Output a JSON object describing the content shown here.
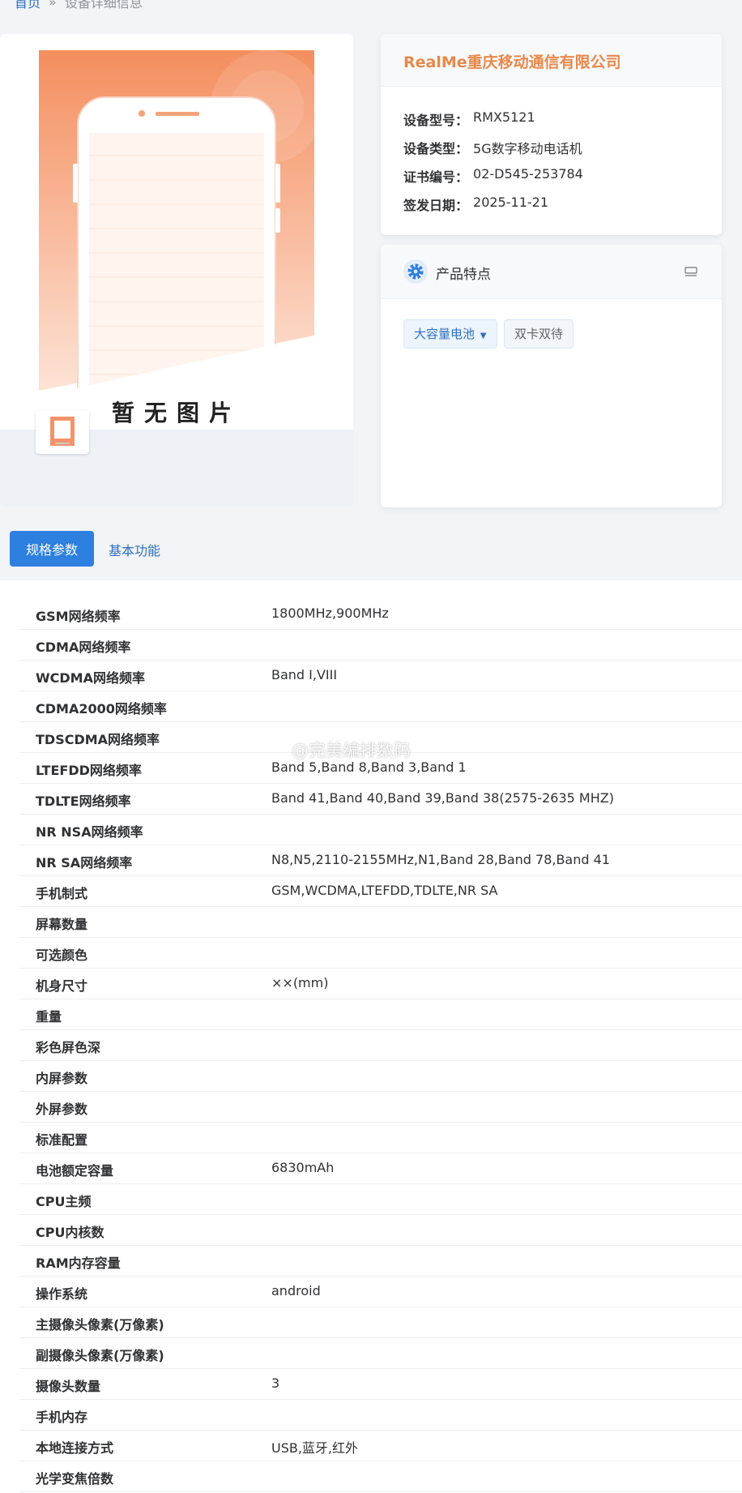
{
  "breadcrumb": {
    "home": "首页",
    "sep": "»",
    "current": "设备详细信息"
  },
  "image_card": {
    "placeholder_text": "暂无图片"
  },
  "info": {
    "company": "RealMe重庆移动通信有限公司",
    "rows": [
      {
        "k": "设备型号：",
        "v": "RMX5121"
      },
      {
        "k": "设备类型：",
        "v": "5G数字移动电话机"
      },
      {
        "k": "证书编号：",
        "v": "02-D545-253784"
      },
      {
        "k": "签发日期：",
        "v": "2025-11-21"
      }
    ]
  },
  "features": {
    "title": "产品特点",
    "tags": [
      "大容量电池",
      "双卡双待"
    ]
  },
  "tabs": {
    "active": "规格参数",
    "other": "基本功能"
  },
  "specs": [
    {
      "k": "GSM网络频率",
      "v": "1800MHz,900MHz"
    },
    {
      "k": "CDMA网络频率",
      "v": ""
    },
    {
      "k": "WCDMA网络频率",
      "v": "Band I,VIII"
    },
    {
      "k": "CDMA2000网络频率",
      "v": ""
    },
    {
      "k": "TDSCDMA网络频率",
      "v": ""
    },
    {
      "k": "LTEFDD网络频率",
      "v": "Band 5,Band 8,Band 3,Band 1"
    },
    {
      "k": "TDLTE网络频率",
      "v": "Band 41,Band 40,Band 39,Band 38(2575-2635 MHZ)"
    },
    {
      "k": "NR NSA网络频率",
      "v": ""
    },
    {
      "k": "NR SA网络频率",
      "v": "N8,N5,2110-2155MHz,N1,Band 28,Band 78,Band 41"
    },
    {
      "k": "手机制式",
      "v": "GSM,WCDMA,LTEFDD,TDLTE,NR SA"
    },
    {
      "k": "屏幕数量",
      "v": ""
    },
    {
      "k": "可选颜色",
      "v": ""
    },
    {
      "k": "机身尺寸",
      "v": "××(mm)"
    },
    {
      "k": "重量",
      "v": ""
    },
    {
      "k": "彩色屏色深",
      "v": ""
    },
    {
      "k": "内屏参数",
      "v": ""
    },
    {
      "k": "外屏参数",
      "v": ""
    },
    {
      "k": "标准配置",
      "v": ""
    },
    {
      "k": "电池额定容量",
      "v": "6830mAh"
    },
    {
      "k": "CPU主频",
      "v": ""
    },
    {
      "k": "CPU内核数",
      "v": ""
    },
    {
      "k": "RAM内存容量",
      "v": ""
    },
    {
      "k": "操作系统",
      "v": "android"
    },
    {
      "k": "主摄像头像素(万像素)",
      "v": ""
    },
    {
      "k": "副摄像头像素(万像素)",
      "v": ""
    },
    {
      "k": "摄像头数量",
      "v": "3"
    },
    {
      "k": "手机内存",
      "v": ""
    },
    {
      "k": "本地连接方式",
      "v": "USB,蓝牙,红外"
    },
    {
      "k": "光学变焦倍数",
      "v": ""
    }
  ],
  "watermark": "@完美编排数码",
  "colors": {
    "accent": "#2d7fe0",
    "company": "#e8894a",
    "placeholder_orange": "#f6a07a"
  }
}
